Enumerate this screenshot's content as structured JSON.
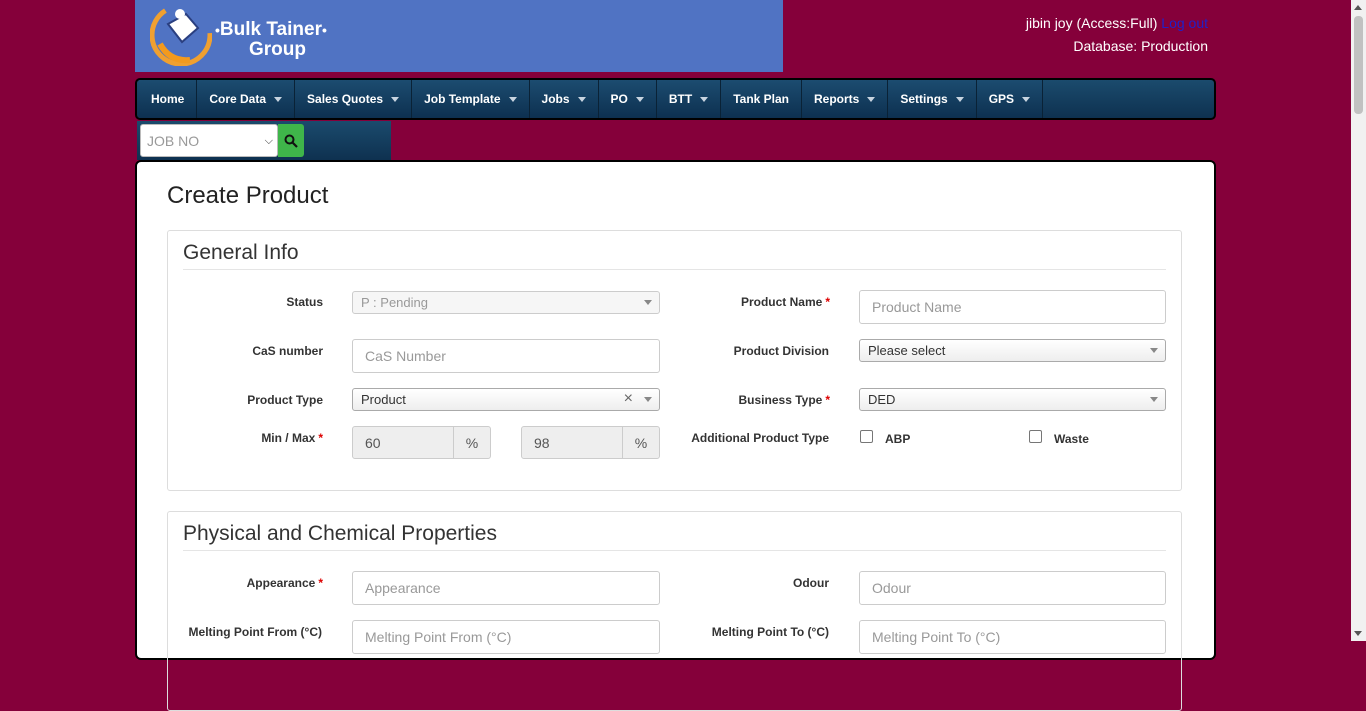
{
  "header": {
    "logo_line1": "Bulk Tainer",
    "logo_line2": "Group",
    "user": "jibin joy (Access:Full)",
    "logout": "Log out",
    "database": "Database: Production"
  },
  "nav": {
    "items": [
      {
        "label": "Home",
        "dropdown": false
      },
      {
        "label": "Core Data",
        "dropdown": true
      },
      {
        "label": "Sales Quotes",
        "dropdown": true
      },
      {
        "label": "Job Template",
        "dropdown": true
      },
      {
        "label": "Jobs",
        "dropdown": true
      },
      {
        "label": "PO",
        "dropdown": true
      },
      {
        "label": "BTT",
        "dropdown": true
      },
      {
        "label": "Tank Plan",
        "dropdown": false
      },
      {
        "label": "Reports",
        "dropdown": true
      },
      {
        "label": "Settings",
        "dropdown": true
      },
      {
        "label": "GPS",
        "dropdown": true
      }
    ]
  },
  "search": {
    "select_value": "JOB NO"
  },
  "page": {
    "title": "Create Product"
  },
  "general": {
    "title": "General Info",
    "status_label": "Status",
    "status_value": "P : Pending",
    "product_name_label": "Product Name",
    "product_name_placeholder": "Product Name",
    "cas_label": "CaS number",
    "cas_placeholder": "CaS Number",
    "division_label": "Product Division",
    "division_value": "Please select",
    "type_label": "Product Type",
    "type_value": "Product",
    "business_label": "Business Type",
    "business_value": "DED",
    "minmax_label": "Min / Max",
    "min_value": "60",
    "max_value": "98",
    "percent": "%",
    "additional_label": "Additional Product Type",
    "abp_label": "ABP",
    "waste_label": "Waste"
  },
  "physical": {
    "title": "Physical and Chemical Properties",
    "appearance_label": "Appearance",
    "appearance_placeholder": "Appearance",
    "odour_label": "Odour",
    "odour_placeholder": "Odour",
    "melt_from_label": "Melting Point From (°C)",
    "melt_from_placeholder": "Melting Point From (°C)",
    "melt_to_label": "Melting Point To (°C)",
    "melt_to_placeholder": "Melting Point To (°C)"
  },
  "colors": {
    "background": "#85003a",
    "logo_bg": "#5073c3",
    "nav_bg": "#0e3150",
    "search_button": "#3fb54a"
  }
}
